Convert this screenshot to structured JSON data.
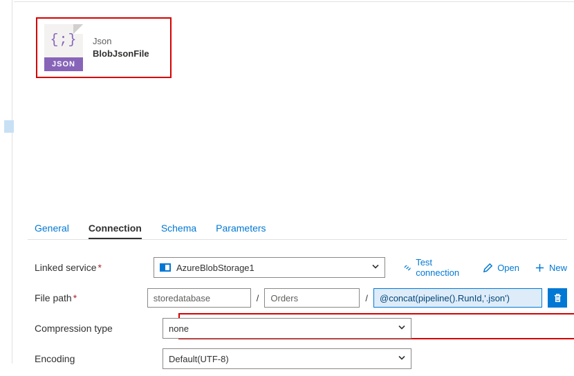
{
  "dataset": {
    "type_label": "Json",
    "name": "BlobJsonFile",
    "icon_band": "JSON",
    "icon_glyph": "{;}"
  },
  "tabs": {
    "general": "General",
    "connection": "Connection",
    "schema": "Schema",
    "parameters": "Parameters"
  },
  "form": {
    "linked_service": {
      "label": "Linked service",
      "value": "AzureBlobStorage1"
    },
    "actions": {
      "test": "Test connection",
      "open": "Open",
      "new": "New"
    },
    "file_path": {
      "label": "File path",
      "container": "storedatabase",
      "folder": "Orders",
      "file_expr": "@concat(pipeline().RunId,'.json')"
    },
    "compression": {
      "label": "Compression type",
      "value": "none"
    },
    "encoding": {
      "label": "Encoding",
      "value": "Default(UTF-8)"
    }
  }
}
